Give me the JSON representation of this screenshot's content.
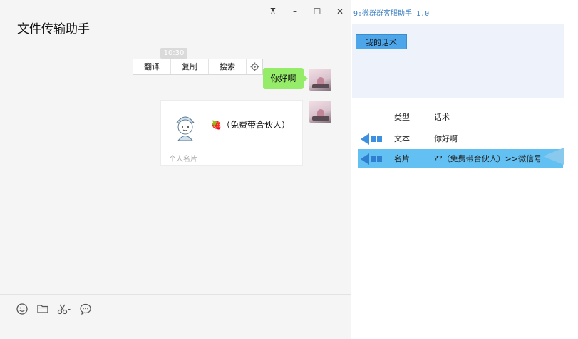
{
  "chat": {
    "title": "文件传输助手",
    "window_controls": [
      "⊼",
      "–",
      "☐",
      "✕"
    ],
    "timestamp": "10:30",
    "context_menu": [
      "翻译",
      "复制",
      "搜索"
    ],
    "message": "你好啊",
    "card": {
      "name": "🍓（免费带合伙人）",
      "type_label": "个人名片"
    },
    "toolbar_icons": [
      "emoji-icon",
      "folder-icon",
      "scissors-icon",
      "chat-bubble-icon"
    ]
  },
  "tool": {
    "title": "9:微群群客服助手 1.0",
    "my_scripts_button": "我的话术",
    "table": {
      "headers": [
        "类型",
        "话术"
      ],
      "rows": [
        {
          "type": "文本",
          "content": "你好啊",
          "selected": false
        },
        {
          "type": "名片",
          "content": "??（免费带合伙人）>>微信号",
          "selected": true
        }
      ]
    }
  },
  "colors": {
    "bubble": "#95ec69",
    "accent_blue": "#4ea6ea",
    "selected_row": "#63c0f3",
    "title_blue": "#3a7fc1"
  }
}
